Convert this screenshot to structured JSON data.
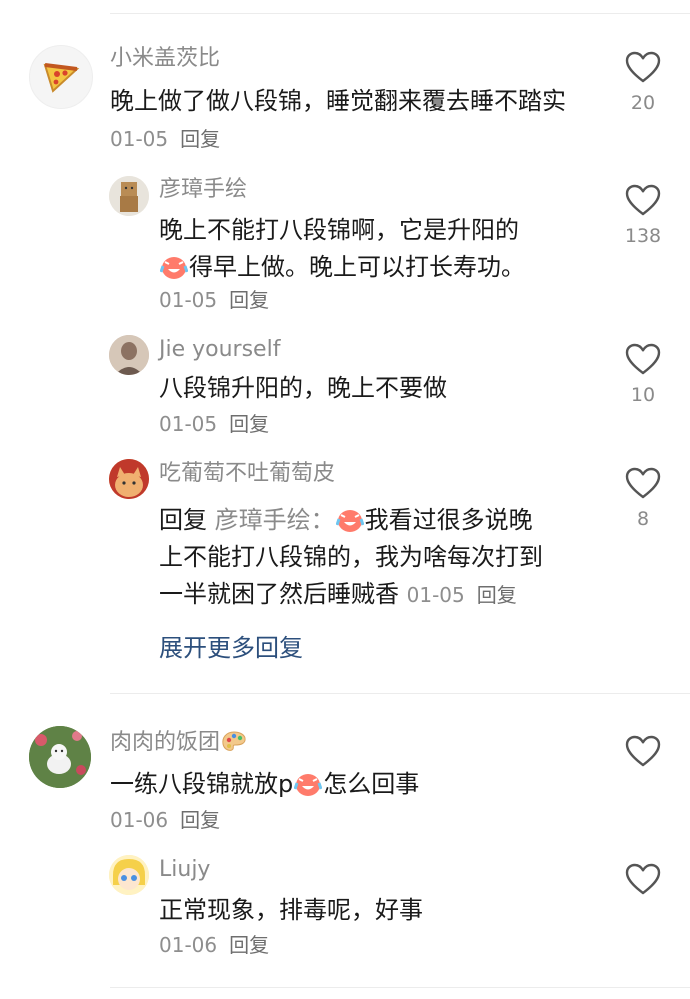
{
  "comments": [
    {
      "user": "小米盖茨比",
      "text": "晚上做了做八段锦，睡觉翻来覆去睡不踏实",
      "date": "01-05",
      "reply_label": "回复",
      "likes": "20",
      "replies": [
        {
          "user": "彦璋手绘",
          "text_a": "晚上不能打八段锦啊，它是升阳的",
          "text_b": "得早上做。晚上可以打长寿功。",
          "date": "01-05",
          "reply_label": "回复",
          "likes": "138"
        },
        {
          "user": "Jie yourself",
          "text": "八段锦升阳的，晚上不要做",
          "date": "01-05",
          "reply_label": "回复",
          "likes": "10"
        },
        {
          "user": "吃葡萄不吐葡萄皮",
          "reply_prefix": "回复",
          "mention": "彦璋手绘：",
          "text_line1": "我看过很多说晚",
          "text_line2": "上不能打八段锦的，我为啥每次打到",
          "text_line3": "一半就困了然后睡贼香",
          "date": "01-05",
          "reply_label": "回复",
          "likes": "8"
        }
      ],
      "expand_label": "展开更多回复"
    },
    {
      "user": "肉肉的饭团",
      "text_a": "一练八段锦就放p",
      "text_b": "怎么回事",
      "date": "01-06",
      "reply_label": "回复",
      "likes": "",
      "replies": [
        {
          "user": "Liujy",
          "text": "正常现象，排毒呢，好事",
          "date": "01-06",
          "reply_label": "回复",
          "likes": ""
        }
      ]
    }
  ],
  "icons": {
    "like": "heart-outline-icon",
    "emoji": "crying-laughing-emoji-icon",
    "palette": "palette-emoji-icon"
  },
  "colors": {
    "username": "#8a8a8a",
    "expand_link": "#2c4f7c",
    "heart_stroke": "#555555"
  }
}
